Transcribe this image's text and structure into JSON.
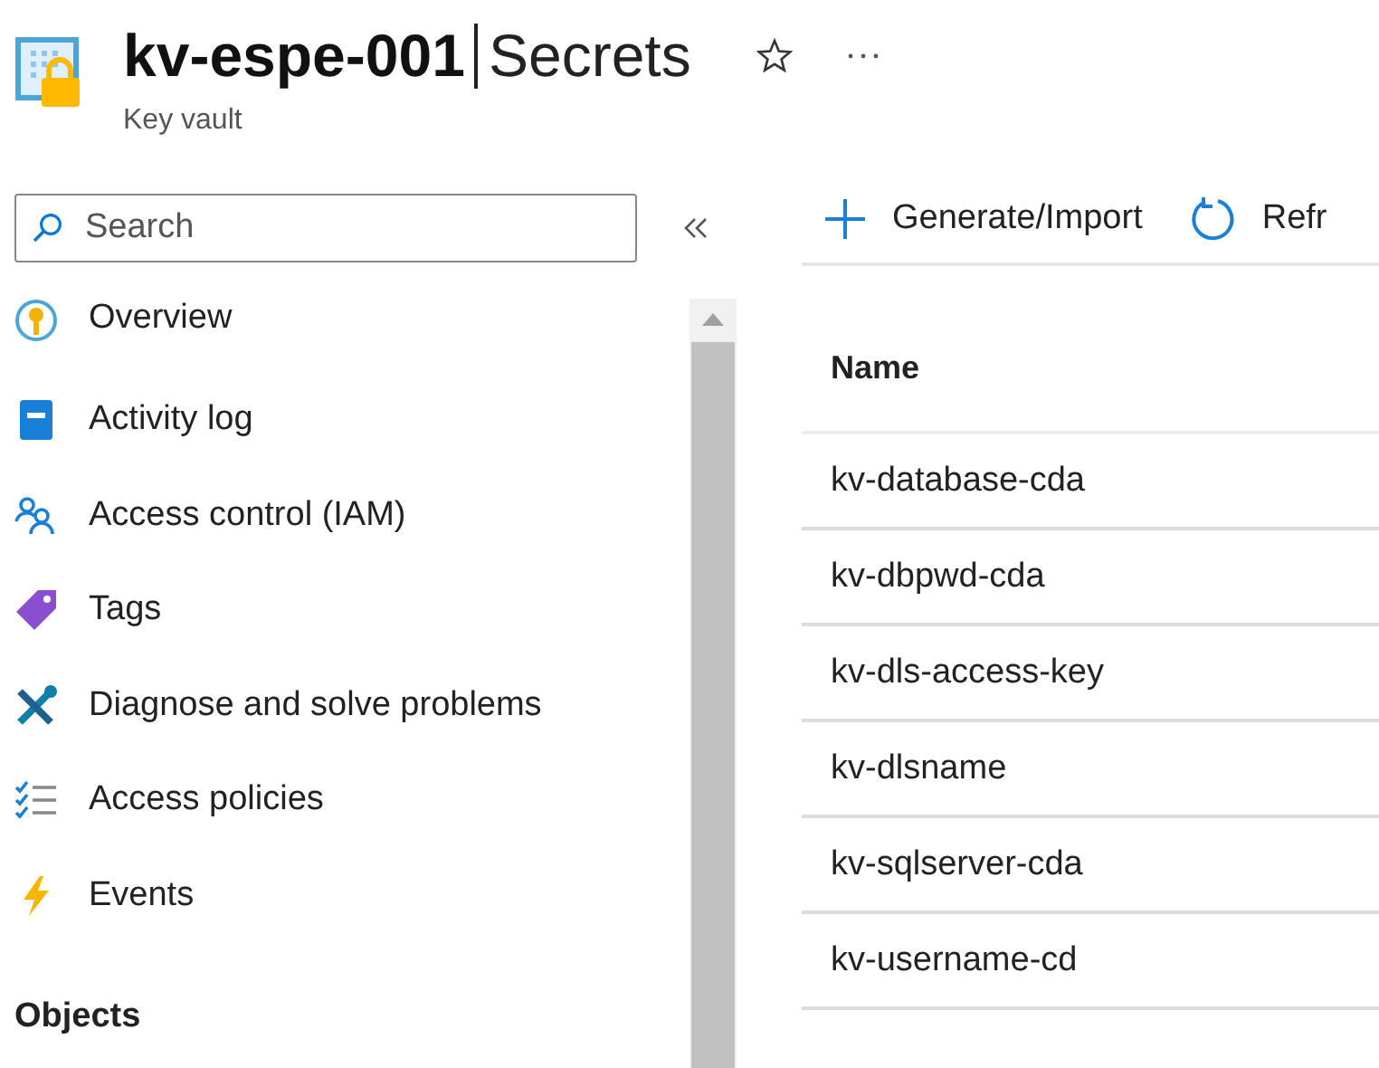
{
  "header": {
    "resource_name": "kv-espe-001",
    "page": "Secrets",
    "subtitle": "Key vault"
  },
  "sidebar": {
    "search": {
      "placeholder": "Search"
    },
    "items": [
      {
        "kind": "overview",
        "label": "Overview"
      },
      {
        "kind": "activity",
        "label": "Activity log"
      },
      {
        "kind": "iam",
        "label": "Access control (IAM)"
      },
      {
        "kind": "tags",
        "label": "Tags"
      },
      {
        "kind": "diagnose",
        "label": "Diagnose and solve problems"
      },
      {
        "kind": "policies",
        "label": "Access policies"
      },
      {
        "kind": "events",
        "label": "Events"
      }
    ],
    "section": "Objects"
  },
  "toolbar": [
    {
      "kind": "add",
      "label": "Generate/Import"
    },
    {
      "kind": "refresh",
      "label": "Refr"
    }
  ],
  "table": {
    "columns": [
      "Name"
    ],
    "rows": [
      [
        "kv-database-cda"
      ],
      [
        "kv-dbpwd-cda"
      ],
      [
        "kv-dls-access-key"
      ],
      [
        "kv-dlsname"
      ],
      [
        "kv-sqlserver-cda"
      ],
      [
        "kv-username-cd"
      ]
    ]
  }
}
